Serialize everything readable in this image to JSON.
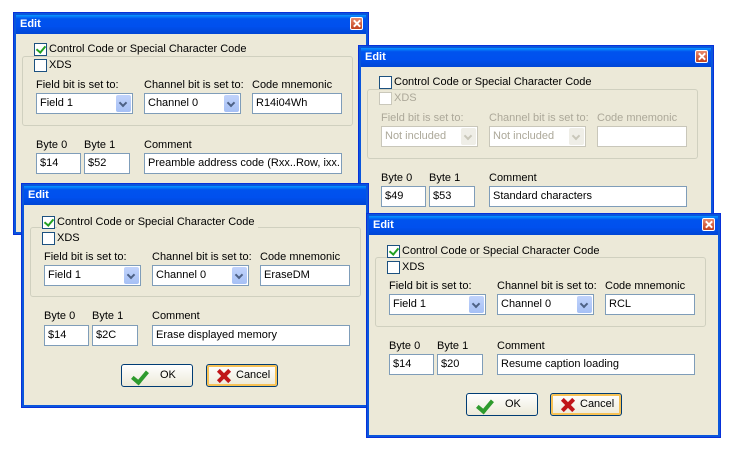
{
  "dialogs": [
    {
      "title": "Edit",
      "control_code_label": "Control Code or Special Character Code",
      "control_code_checked": true,
      "xds_label": "XDS",
      "xds_checked": false,
      "field_bit_label": "Field bit is set to:",
      "field_bit_value": "Field 1",
      "channel_bit_label": "Channel bit is set to:",
      "channel_bit_value": "Channel 0",
      "mnemonic_label": "Code mnemonic",
      "mnemonic_value": "R14i04Wh",
      "byte0_label": "Byte 0",
      "byte0_value": "$14",
      "byte1_label": "Byte 1",
      "byte1_value": "$52",
      "comment_label": "Comment",
      "comment_value": "Preamble address code (Rxx..Row, ixx..I"
    },
    {
      "title": "Edit",
      "control_code_label": "Control Code or Special Character Code",
      "control_code_checked": false,
      "xds_label": "XDS",
      "xds_checked": false,
      "field_bit_label": "Field bit is set to:",
      "field_bit_value": "Not included",
      "channel_bit_label": "Channel bit is set to:",
      "channel_bit_value": "Not included",
      "mnemonic_label": "Code mnemonic",
      "mnemonic_value": "",
      "byte0_label": "Byte 0",
      "byte0_value": "$49",
      "byte1_label": "Byte 1",
      "byte1_value": "$53",
      "comment_label": "Comment",
      "comment_value": "Standard characters"
    },
    {
      "title": "Edit",
      "control_code_label": "Control Code or Special Character Code",
      "control_code_checked": true,
      "xds_label": "XDS",
      "xds_checked": false,
      "field_bit_label": "Field bit is set to:",
      "field_bit_value": "Field 1",
      "channel_bit_label": "Channel bit is set to:",
      "channel_bit_value": "Channel 0",
      "mnemonic_label": "Code mnemonic",
      "mnemonic_value": "EraseDM",
      "byte0_label": "Byte 0",
      "byte0_value": "$14",
      "byte1_label": "Byte 1",
      "byte1_value": "$2C",
      "comment_label": "Comment",
      "comment_value": "Erase displayed memory",
      "ok_label": "OK",
      "cancel_label": "Cancel"
    },
    {
      "title": "Edit",
      "control_code_label": "Control Code or Special Character Code",
      "control_code_checked": true,
      "xds_label": "XDS",
      "xds_checked": false,
      "field_bit_label": "Field bit is set to:",
      "field_bit_value": "Field 1",
      "channel_bit_label": "Channel bit is set to:",
      "channel_bit_value": "Channel 0",
      "mnemonic_label": "Code mnemonic",
      "mnemonic_value": "RCL",
      "byte0_label": "Byte 0",
      "byte0_value": "$14",
      "byte1_label": "Byte 1",
      "byte1_value": "$20",
      "comment_label": "Comment",
      "comment_value": "Resume caption loading",
      "ok_label": "OK",
      "cancel_label": "Cancel"
    }
  ],
  "colors": {
    "titlebar": "#0054e3",
    "dialog_bg": "#ece9d8",
    "disabled_text": "#aca899",
    "ok_icon": "#2e9b2e",
    "cancel_icon": "#c0161a"
  },
  "icons": {
    "close": "close-icon",
    "ok": "checkmark-icon",
    "cancel": "x-mark-icon"
  }
}
